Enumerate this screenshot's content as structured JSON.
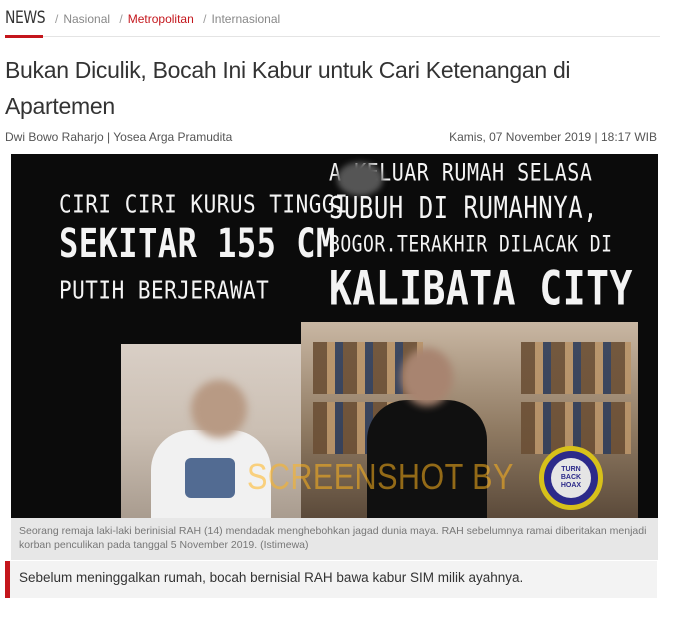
{
  "nav": {
    "brand": "NEWS",
    "crumbs": [
      {
        "label": "Nasional",
        "active": false
      },
      {
        "label": "Metropolitan",
        "active": true
      },
      {
        "label": "Internasional",
        "active": false
      }
    ],
    "separator": "/",
    "accent_color": "#c4161c"
  },
  "article": {
    "title": "Bukan Diculik, Bocah Ini Kabur untuk Cari Ketenangan di Apartemen",
    "authors": "Dwi Bowo Raharjo | Yosea Arga Pramudita",
    "datetime": "Kamis, 07 November 2019 | 18:17 WIB",
    "lead": "Sebelum meninggalkan rumah, bocah bernisial RAH bawa kabur SIM milik ayahnya."
  },
  "photo": {
    "overlay_left": [
      "CIRI CIRI KURUS TINGGI",
      "SEKITAR 155 CM",
      "PUTIH BERJERAWAT"
    ],
    "overlay_right": [
      "A      KELUAR RUMAH SELASA",
      "SUBUH DI RUMAHNYA,",
      "BOGOR.TERAKHIR DILACAK DI",
      "KALIBATA CITY"
    ],
    "watermark": "SCREENSHOT BY",
    "badge_lines": [
      "TURN",
      "BACK",
      "HOAX"
    ],
    "caption": "Seorang remaja laki-laki berinisial RAH (14) mendadak menghebohkan jagad dunia maya. RAH sebelumnya ramai diberitakan menjadi korban penculikan pada tanggal 5 November 2019. (Istimewa)"
  }
}
